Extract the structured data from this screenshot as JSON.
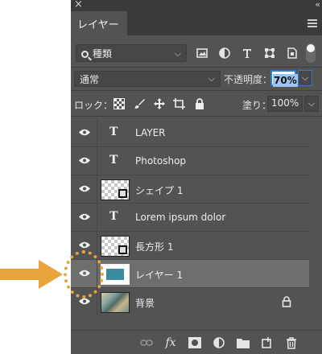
{
  "panel": {
    "tab_label": "レイヤー",
    "filter": {
      "label": "種類"
    },
    "blend": {
      "mode": "通常",
      "opacity_label": "不透明度：",
      "opacity_value": "70%"
    },
    "lock": {
      "label": "ロック：",
      "fill_label": "塗り：",
      "fill_value": "100%"
    },
    "layers": [
      {
        "name": "LAYER",
        "kind": "text"
      },
      {
        "name": "Photoshop",
        "kind": "text"
      },
      {
        "name": "シェイプ 1",
        "kind": "shape"
      },
      {
        "name": "Lorem ipsum dolor",
        "kind": "text"
      },
      {
        "name": "長方形 1",
        "kind": "shape"
      },
      {
        "name": "レイヤー 1",
        "kind": "pixel",
        "selected": true
      },
      {
        "name": "背景",
        "kind": "background",
        "locked": true
      }
    ],
    "bottom_toolbar": {
      "fx_label": "fx"
    }
  },
  "colors": {
    "panel_bg": "#535353",
    "selected_row": "#6e6e6e",
    "accent_blue": "#2f7bd0",
    "annotation": "#e8a33a",
    "layer_thumb": "#3a8aa0"
  },
  "icons": [
    "close-icon",
    "collapse-icon",
    "panel-menu-icon",
    "search-icon",
    "image-filter-icon",
    "adjustment-filter-icon",
    "text-filter-icon",
    "shape-filter-icon",
    "smart-object-filter-icon",
    "filter-toggle",
    "lock-transparent-icon",
    "lock-brush-icon",
    "lock-move-icon",
    "lock-artboard-icon",
    "lock-all-icon",
    "eye-icon",
    "link-icon",
    "fx-icon",
    "mask-icon",
    "adjustment-icon",
    "folder-icon",
    "new-layer-icon",
    "trash-icon"
  ]
}
